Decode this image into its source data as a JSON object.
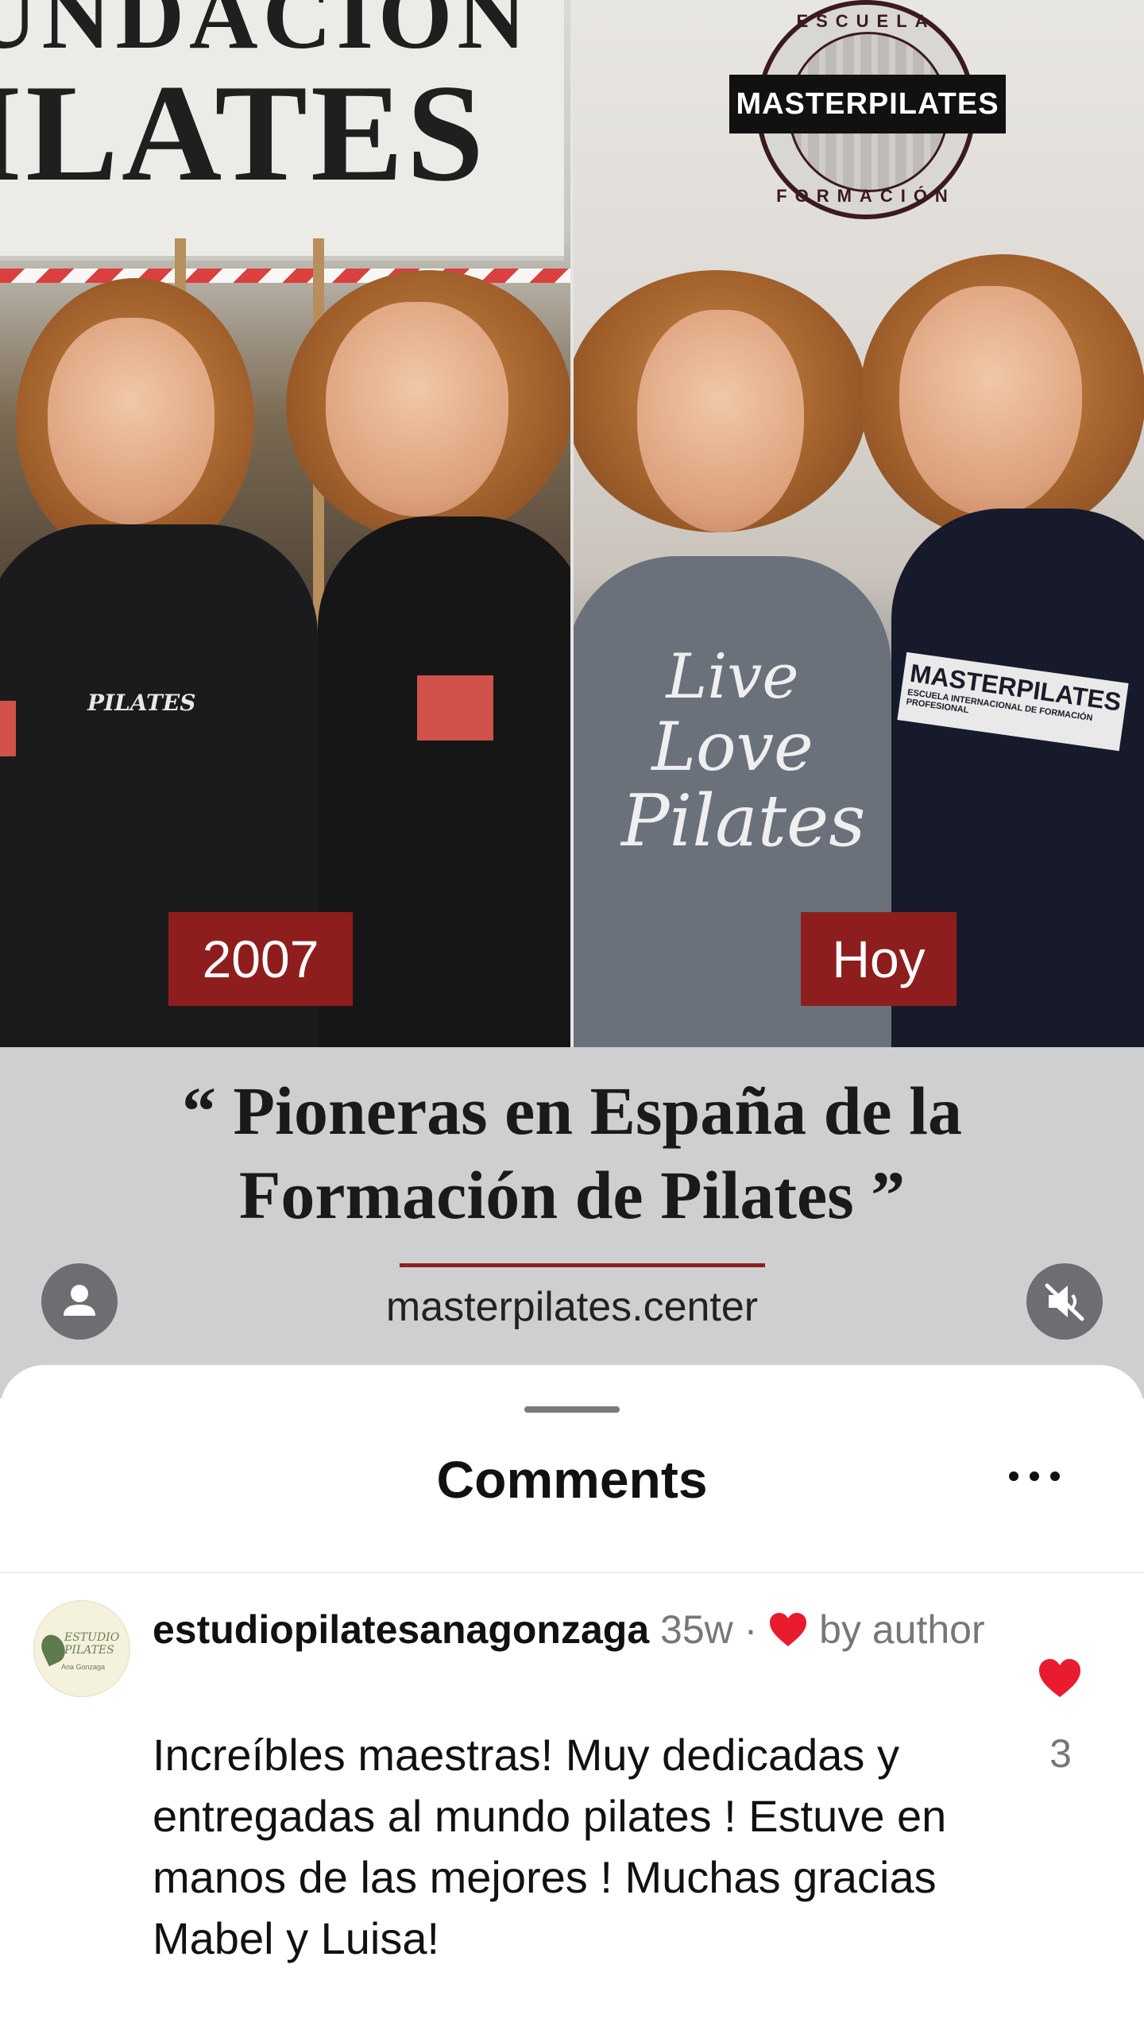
{
  "video": {
    "banner_line1": "UNDACION",
    "banner_line2": "ILATES",
    "logo": {
      "top_text": "ESCUELA",
      "bar_text": "MASTERPILATES",
      "bottom_text": "FORMACIÓN"
    },
    "left_chest_logo": "PILATES",
    "left_label": "2007",
    "right_label": "Hoy",
    "shirt_text": [
      "Live",
      "Love",
      "Pilates"
    ],
    "shirt_brand": "MASTERPILATES",
    "shirt_brand_sub": "ESCUELA INTERNACIONAL DE FORMACIÓN PROFESIONAL",
    "quote_line1": "“ Pioneras en España de la",
    "quote_line2": "Formación de Pilates ”",
    "site": "masterpilates.center",
    "accent_color": "#8e1e1e"
  },
  "comments_sheet": {
    "title": "Comments",
    "more_icon": "more-horizontal-icon",
    "comments": [
      {
        "avatar_text": "ESTUDIO PILATES",
        "avatar_sub": "Ana Gonzaga",
        "username": "estudiopilatesanagonzaga",
        "time": "35w",
        "separator": "·",
        "liked_by": "by author",
        "text": "Increíbles maestras!  Muy dedicadas y entregadas al mundo pilates ! Estuve en manos de las mejores !  Muchas gracias Mabel y Luisa!",
        "likes": "3"
      }
    ]
  }
}
